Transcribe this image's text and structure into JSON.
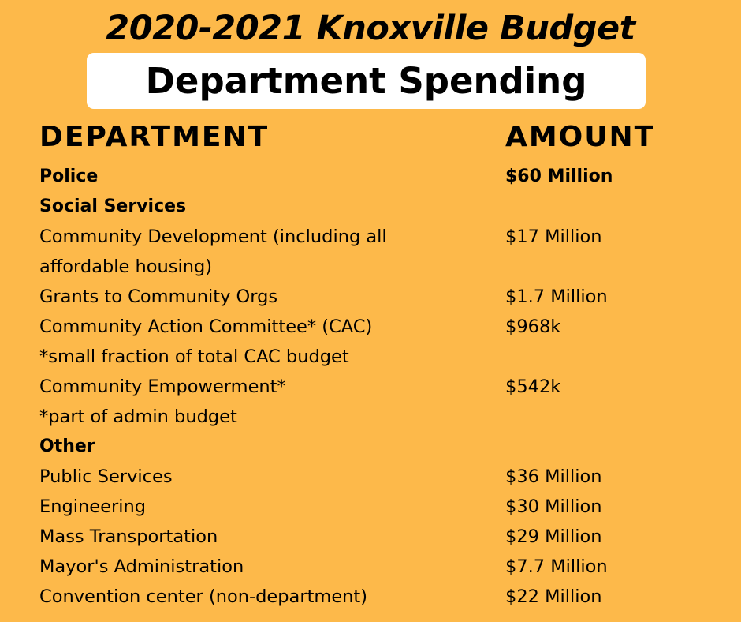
{
  "header": {
    "title": "2020-2021 Knoxville Budget",
    "subtitle": "Department Spending"
  },
  "table": {
    "columns": [
      "DEPARTMENT",
      "AMOUNT"
    ],
    "rows": [
      {
        "department": "Police",
        "amount": "$60 Million",
        "bold": true
      },
      {
        "department": "Social Services",
        "amount": "",
        "bold": true
      },
      {
        "department": "Community Development (including all",
        "amount": "$17 Million",
        "bold": false
      },
      {
        "department": "affordable housing)",
        "amount": "",
        "bold": false
      },
      {
        "department": "Grants to Community Orgs",
        "amount": "$1.7 Million",
        "bold": false
      },
      {
        "department": "Community Action Committee* (CAC)",
        "amount": "$968k",
        "bold": false
      },
      {
        "department": "*small fraction of total CAC budget",
        "amount": "",
        "bold": false
      },
      {
        "department": "Community Empowerment*",
        "amount": "$542k",
        "bold": false
      },
      {
        "department": "*part of admin budget",
        "amount": "",
        "bold": false
      },
      {
        "department": "Other",
        "amount": "",
        "bold": true
      },
      {
        "department": "Public Services",
        "amount": "$36 Million",
        "bold": false
      },
      {
        "department": "Engineering",
        "amount": "$30 Million",
        "bold": false
      },
      {
        "department": "Mass Transportation",
        "amount": "$29 Million",
        "bold": false
      },
      {
        "department": "Mayor's Administration",
        "amount": "$7.7 Million",
        "bold": false
      },
      {
        "department": "Convention center (non-department)",
        "amount": "$22 Million",
        "bold": false
      }
    ]
  },
  "colors": {
    "background": "#fdb94a",
    "box": "#ffffff",
    "text": "#000000"
  }
}
